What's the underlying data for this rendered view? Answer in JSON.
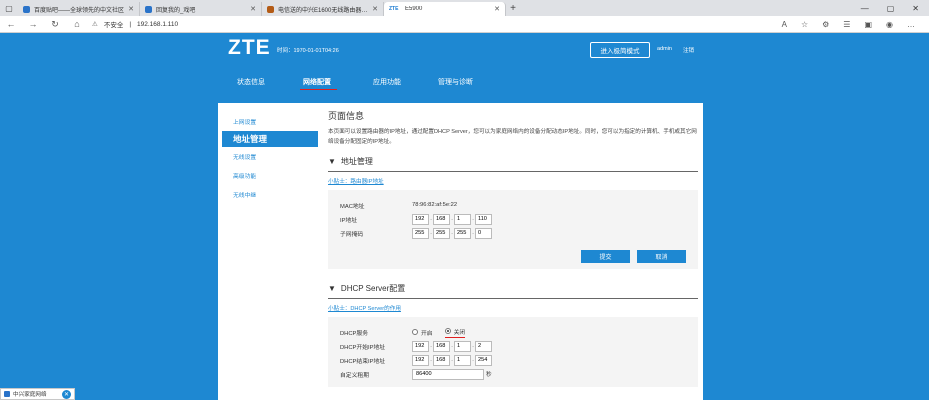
{
  "browser": {
    "tabs": [
      {
        "title": "百度贴吧——全球领先的中文社区",
        "active": false,
        "icon": "baidu-icon"
      },
      {
        "title": "回复我的_戏吧",
        "active": false,
        "icon": "baidu-icon"
      },
      {
        "title": "电信送的中兴E1600无线路由器优化...",
        "active": false,
        "icon": "orange-icon"
      },
      {
        "title": "E5900",
        "active": true,
        "icon": "zte-icon"
      }
    ],
    "url_warning": "不安全",
    "url": "192.168.1.110"
  },
  "header": {
    "logo": "ZTE",
    "time": "时间：1970-01-01T04:26",
    "quick_mode_button": "进入极简模式",
    "user": "admin",
    "logout": "注销",
    "nav": [
      "状态信息",
      "网络配置",
      "应用功能",
      "管理与诊断"
    ],
    "nav_active": "网络配置"
  },
  "sidebar": {
    "items": [
      "上网设置",
      "地址管理",
      "无线设置",
      "高级功能",
      "无线中继"
    ],
    "active": "地址管理"
  },
  "page_info": {
    "title": "页面信息",
    "description": "本页面可以设置路由器的IP地址，通过配置DHCP Server，您可以为家庭网络内的设备分配动态IP地址。同时，您可以为指定的计算机、手机或其它网络设备分配固定的IP地址。"
  },
  "address": {
    "title": "地址管理",
    "tip": "小贴士：路由器IP地址",
    "mac_label": "MAC地址",
    "mac_value": "78:96:82:af:5e:22",
    "ip_label": "IP地址",
    "ip": [
      "192",
      "168",
      "1",
      "110"
    ],
    "mask_label": "子网掩码",
    "mask": [
      "255",
      "255",
      "255",
      "0"
    ],
    "submit": "提交",
    "cancel": "取消"
  },
  "dhcp": {
    "title": "DHCP Server配置",
    "tip": "小贴士：DHCP Server的作用",
    "service_label": "DHCP服务",
    "on_label": "开启",
    "off_label": "关闭",
    "selected": "关闭",
    "start_label": "DHCP开始IP地址",
    "start_ip": [
      "192",
      "168",
      "1",
      "2"
    ],
    "end_label": "DHCP结束IP地址",
    "end_ip": [
      "192",
      "168",
      "1",
      "254"
    ],
    "lease_label": "自定义租期",
    "lease_value": "86400",
    "lease_unit": "秒"
  },
  "bottom_tab": {
    "label": "中兴家庭网络"
  },
  "colors": {
    "brand": "#1e88d2",
    "underline": "#e02020"
  }
}
